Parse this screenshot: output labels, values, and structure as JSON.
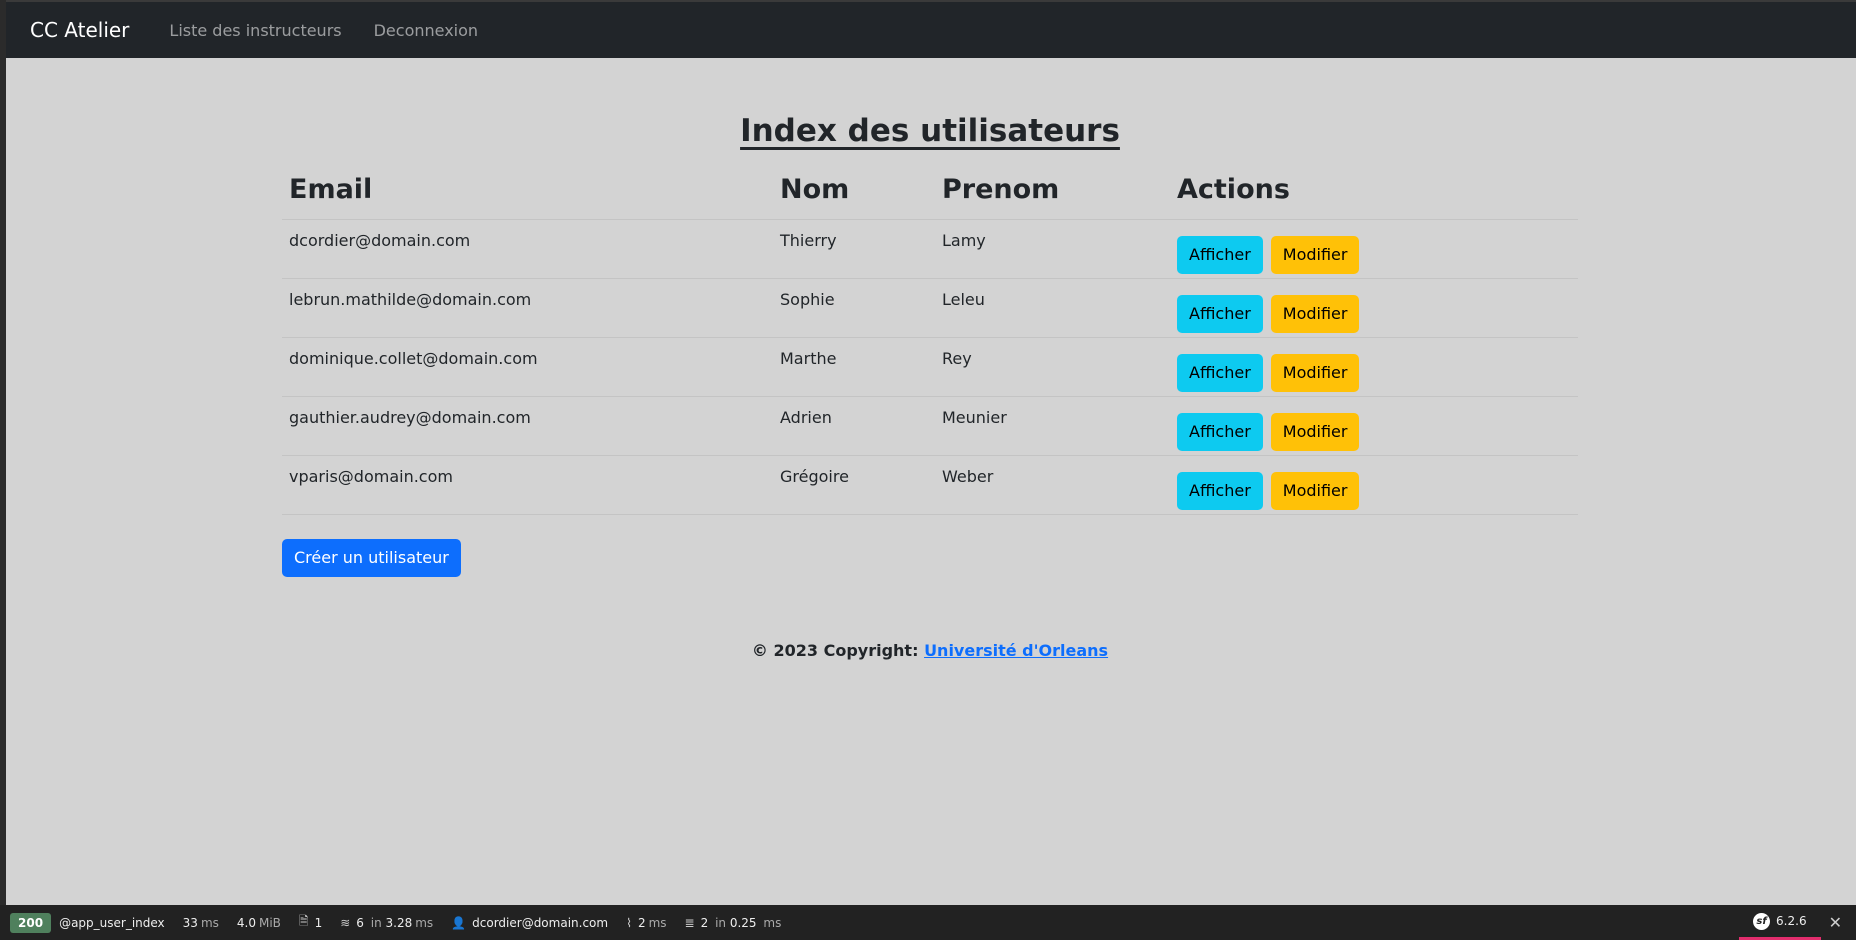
{
  "navbar": {
    "brand": "CC Atelier",
    "links": [
      "Liste des instructeurs",
      "Deconnexion"
    ]
  },
  "page": {
    "title": "Index des utilisateurs"
  },
  "table": {
    "headers": [
      "Email",
      "Nom",
      "Prenom",
      "Actions"
    ],
    "rows": [
      {
        "email": "dcordier@domain.com",
        "nom": "Thierry",
        "prenom": "Lamy"
      },
      {
        "email": "lebrun.mathilde@domain.com",
        "nom": "Sophie",
        "prenom": "Leleu"
      },
      {
        "email": "dominique.collet@domain.com",
        "nom": "Marthe",
        "prenom": "Rey"
      },
      {
        "email": "gauthier.audrey@domain.com",
        "nom": "Adrien",
        "prenom": "Meunier"
      },
      {
        "email": "vparis@domain.com",
        "nom": "Grégoire",
        "prenom": "Weber"
      }
    ],
    "show_label": "Afficher",
    "edit_label": "Modifier"
  },
  "create_button": "Créer un utilisateur",
  "footer": {
    "prefix": "© 2023 Copyright:",
    "link": "Université d'Orleans"
  },
  "debug_toolbar": {
    "status": "200",
    "route": "@app_user_index",
    "time_value": "33",
    "time_unit": "ms",
    "memory_value": "4.0",
    "memory_unit": "MiB",
    "logs": "1",
    "cache_count": "6",
    "cache_in": "in",
    "cache_time": "3.28",
    "cache_unit": "ms",
    "user": "dcordier@domain.com",
    "twig_time": "2",
    "twig_unit": "ms",
    "db_count": "2",
    "db_in": "in",
    "db_time": "0.25",
    "db_unit": "ms",
    "version": "6.2.6",
    "colors": {
      "status_bg": "#4f805d",
      "symfony_accent": "#e22d6d"
    }
  }
}
